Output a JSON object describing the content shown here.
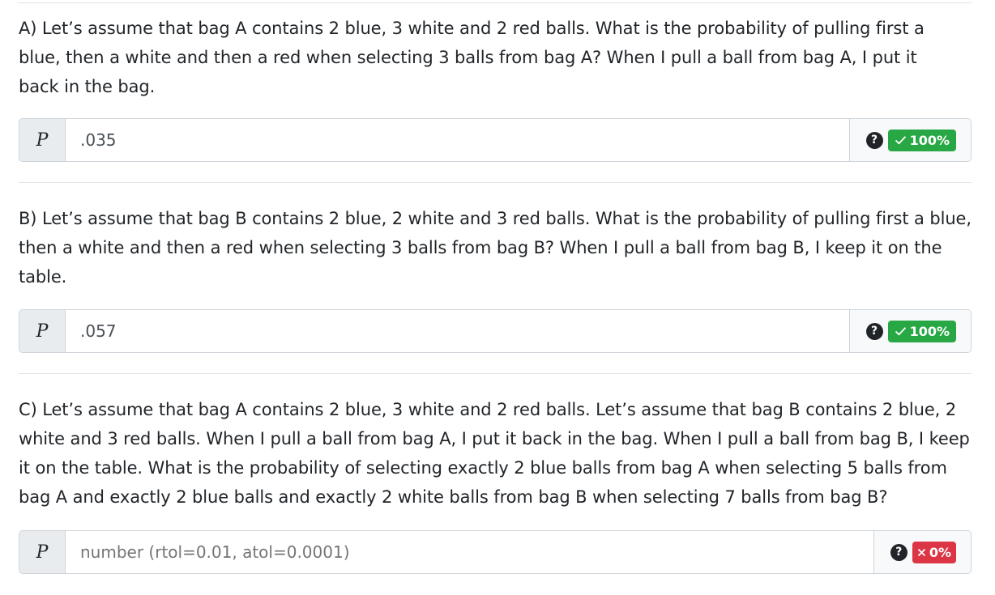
{
  "questions": [
    {
      "text": "A) Let’s assume that bag A contains 2 blue, 3 white and 2 red balls. What is the probability of pulling first a blue, then a white and then a red when selecting 3 balls from bag A? When I pull a ball from bag A, I put it back in the bag.",
      "prefix": "P",
      "value": ".035",
      "placeholder": "",
      "help_icon": "?",
      "score": "100%",
      "status": "correct",
      "status_icon": "check-icon"
    },
    {
      "text": "B) Let’s assume that bag B contains 2 blue, 2 white and 3 red balls. What is the probability of pulling first a blue, then a white and then a red when selecting 3 balls from bag B? When I pull a ball from bag B, I keep it on the table.",
      "prefix": "P",
      "value": ".057",
      "placeholder": "",
      "help_icon": "?",
      "score": "100%",
      "status": "correct",
      "status_icon": "check-icon"
    },
    {
      "text": "C) Let’s assume that bag A contains 2 blue, 3 white and 2 red balls. Let’s assume that bag B contains 2 blue, 2 white and 3 red balls. When I pull a ball from bag A, I put it back in the bag. When I pull a ball from bag B, I keep it on the table. What is the probability of selecting exactly 2 blue balls from bag A when selecting 5 balls from bag A and exactly 2 blue balls and exactly 2 white balls from bag B when selecting 7 balls from bag B?",
      "prefix": "P",
      "value": "",
      "placeholder": "number (rtol=0.01, atol=0.0001)",
      "help_icon": "?",
      "score": "0%",
      "status": "incorrect",
      "status_icon": "x-icon"
    }
  ],
  "colors": {
    "correct": "#28a745",
    "incorrect": "#dc3545",
    "divider": "#dee2e6",
    "prefix_bg": "#e9ecef"
  }
}
